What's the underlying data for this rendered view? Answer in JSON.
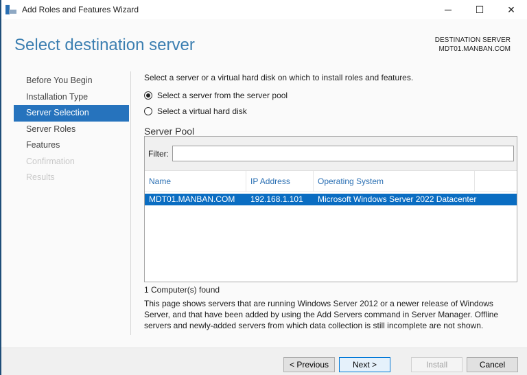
{
  "window": {
    "title": "Add Roles and Features Wizard",
    "minimize": "─",
    "maximize": "☐",
    "close": "✕"
  },
  "header": {
    "title": "Select destination server",
    "dest_label": "DESTINATION SERVER",
    "dest_value": "MDT01.MANBAN.COM"
  },
  "nav": [
    {
      "label": "Before You Begin"
    },
    {
      "label": "Installation Type"
    },
    {
      "label": "Server Selection"
    },
    {
      "label": "Server Roles"
    },
    {
      "label": "Features"
    },
    {
      "label": "Confirmation"
    },
    {
      "label": "Results"
    }
  ],
  "main": {
    "intro": "Select a server or a virtual hard disk on which to install roles and features.",
    "radio_pool": "Select a server from the server pool",
    "radio_vhd": "Select a virtual hard disk",
    "pool_title": "Server Pool",
    "filter_label": "Filter:",
    "filter_value": "",
    "columns": [
      "Name",
      "IP Address",
      "Operating System"
    ],
    "rows": [
      {
        "name": "MDT01.MANBAN.COM",
        "ip": "192.168.1.101",
        "os": "Microsoft Windows Server 2022 Datacenter"
      }
    ],
    "found": "1 Computer(s) found",
    "description": "This page shows servers that are running Windows Server 2012 or a newer release of Windows Server, and that have been added by using the Add Servers command in Server Manager. Offline servers and newly-added servers from which data collection is still incomplete are not shown."
  },
  "footer": {
    "previous": "< Previous",
    "next": "Next >",
    "install": "Install",
    "cancel": "Cancel"
  }
}
